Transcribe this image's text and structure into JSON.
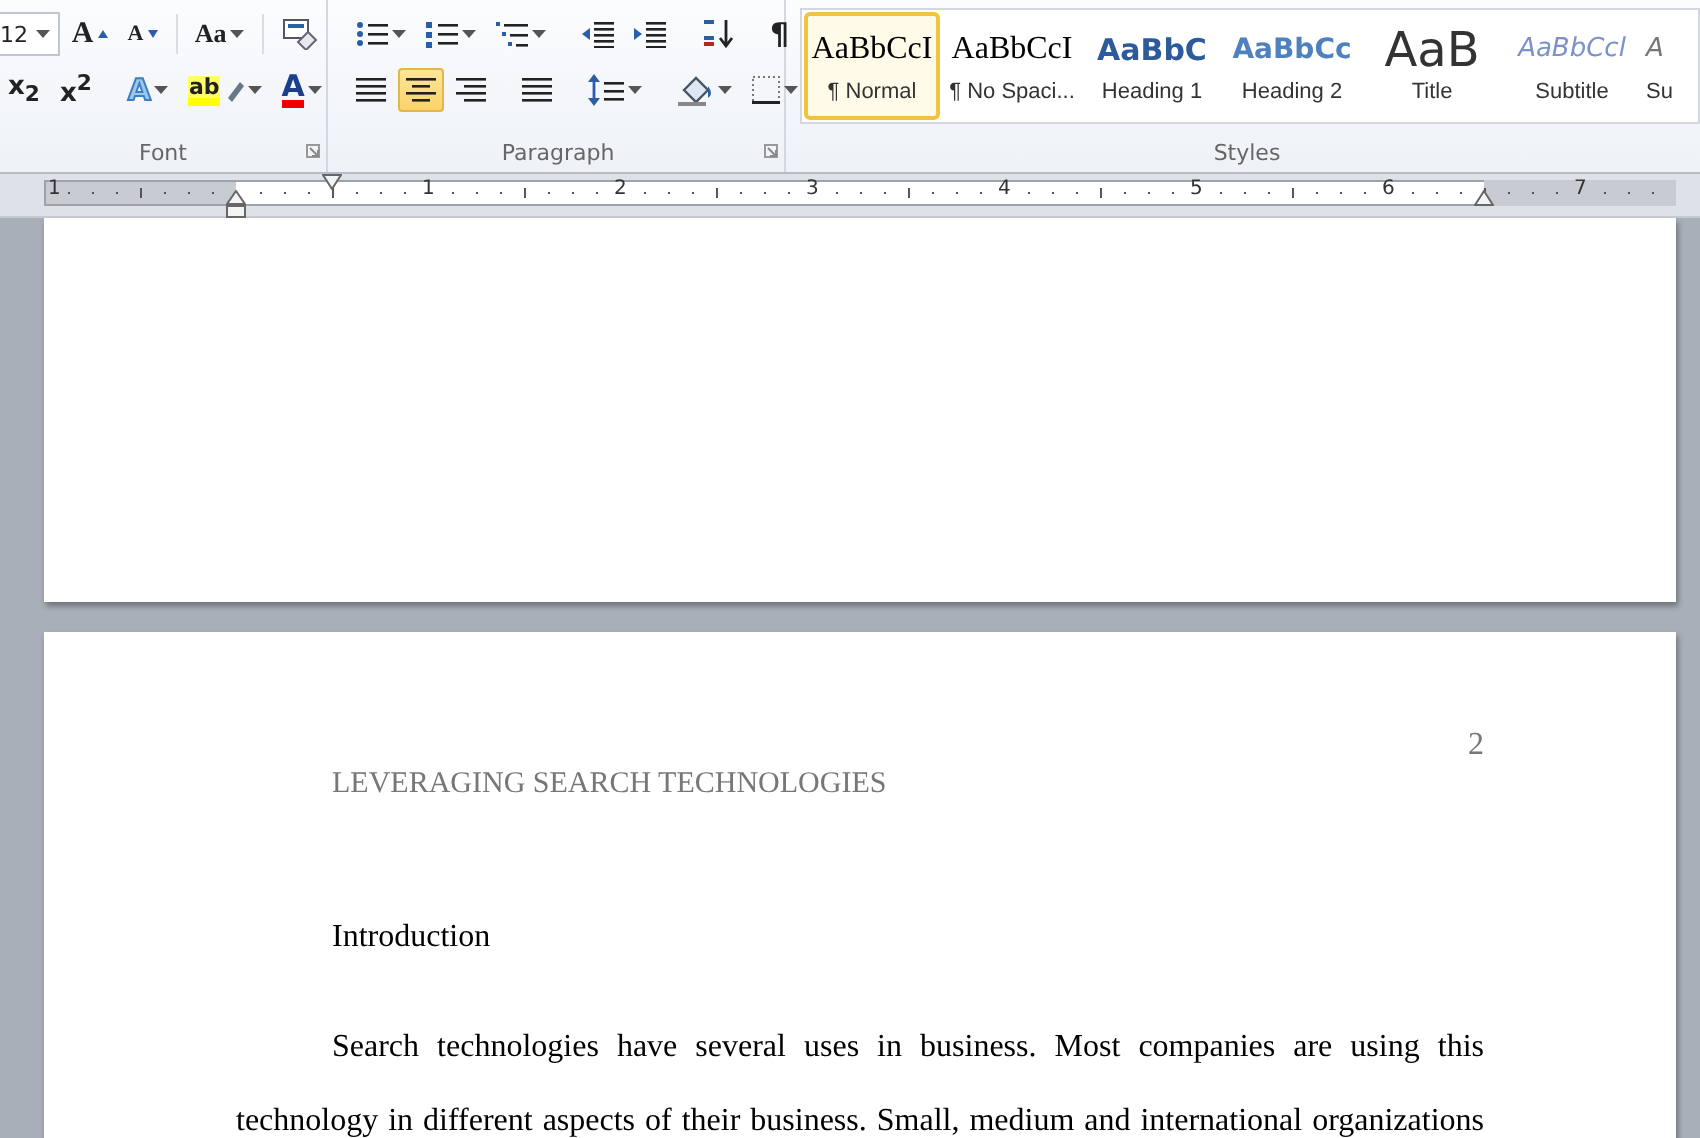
{
  "ribbon": {
    "groups": [
      {
        "kind": "font",
        "label": "Font",
        "launcher": true,
        "rows": [
          [
            {
              "kind": "font-size",
              "value": "12",
              "has_menu": true
            },
            {
              "kind": "grow-font",
              "glyph": "A",
              "has_menu": false
            },
            {
              "kind": "shrink-font",
              "glyph": "A",
              "has_menu": false
            },
            {
              "kind": "change-case",
              "glyph": "Aa",
              "has_menu": true
            },
            {
              "kind": "clear-format",
              "has_menu": false
            }
          ],
          [
            {
              "kind": "subscript",
              "glyph": "x$_{2}$",
              "has_menu": false
            },
            {
              "kind": "superscript",
              "glyph": "x$^{2}$",
              "has_menu": false
            },
            {
              "kind": "text-effects",
              "glyph": "A",
              "has_menu": true
            },
            {
              "kind": "highlight",
              "glyph": "ab",
              "has_menu": true
            },
            {
              "kind": "font-color",
              "glyph": "A",
              "has_menu": true
            }
          ]
        ]
      },
      {
        "kind": "paragraph",
        "label": "Paragraph",
        "launcher": true,
        "rows": [
          [
            {
              "kind": "bullets",
              "has_menu": true
            },
            {
              "kind": "numbering",
              "has_menu": true
            },
            {
              "kind": "multilevel",
              "has_menu": true
            },
            {
              "kind": "outdent",
              "has_menu": false
            },
            {
              "kind": "indent",
              "has_menu": false
            },
            {
              "kind": "sort",
              "has_menu": false
            },
            {
              "kind": "pilcrow",
              "glyph": "¶",
              "has_menu": false
            }
          ],
          [
            {
              "kind": "align-left",
              "has_menu": false,
              "selected": false
            },
            {
              "kind": "align-center",
              "has_menu": false,
              "selected": true
            },
            {
              "kind": "align-right",
              "has_menu": false,
              "selected": false
            },
            {
              "kind": "justify",
              "has_menu": false,
              "selected": false
            },
            {
              "kind": "line-spacing",
              "has_menu": true
            },
            {
              "kind": "shading",
              "has_menu": true
            },
            {
              "kind": "borders",
              "has_menu": true
            }
          ]
        ]
      },
      {
        "kind": "styles",
        "label": "Styles",
        "launcher": false,
        "styles": [
          {
            "kind": "normal",
            "sample": "AaBbCcI",
            "name": "¶ Normal",
            "selected": true
          },
          {
            "kind": "no-spacing",
            "sample": "AaBbCcI",
            "name": "¶ No Spaci...",
            "selected": false
          },
          {
            "kind": "heading1",
            "sample": "AaBbC",
            "name": "Heading 1",
            "selected": false
          },
          {
            "kind": "heading2",
            "sample": "AaBbCc",
            "name": "Heading 2",
            "selected": false
          },
          {
            "kind": "title",
            "sample": "AaB",
            "name": "Title",
            "selected": false
          },
          {
            "kind": "subtitle",
            "sample": "AaBbCcl",
            "name": "Subtitle",
            "selected": false
          },
          {
            "kind": "subtle",
            "sample": "A",
            "name": "Su",
            "selected": false
          }
        ]
      }
    ]
  },
  "ruler": {
    "labels": [
      "1",
      "1",
      "2",
      "3",
      "4",
      "5",
      "6",
      "7"
    ]
  },
  "document": {
    "pages": [
      {
        "kind": "blank"
      },
      {
        "kind": "text",
        "header": "LEVERAGING SEARCH TECHNOLOGIES",
        "page_number": "2",
        "heading": "Introduction",
        "lines": [
          "Search technologies have several uses in business. Most companies are using this",
          "technology in different aspects of their business. Small, medium and international organizations"
        ]
      }
    ]
  }
}
